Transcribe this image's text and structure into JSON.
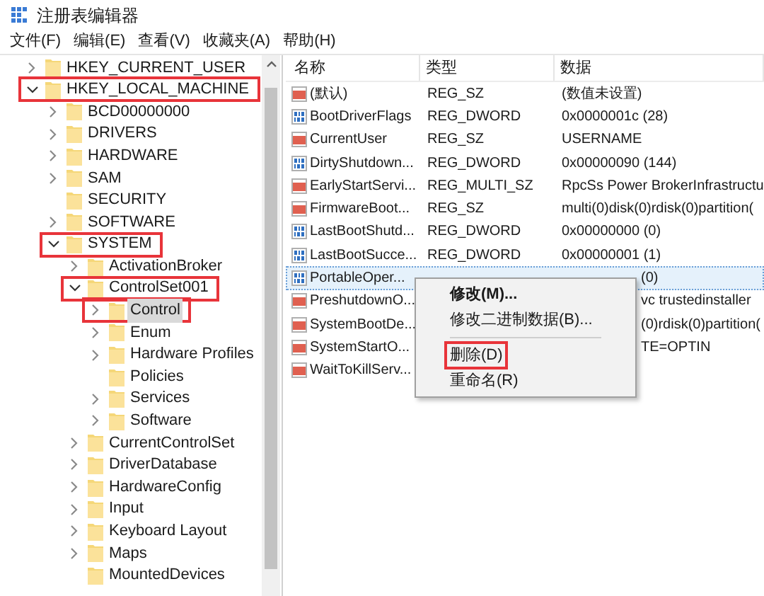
{
  "window": {
    "title": "注册表编辑器"
  },
  "menu_bar": [
    "文件(F)",
    "编辑(E)",
    "查看(V)",
    "收藏夹(A)",
    "帮助(H)"
  ],
  "tree": [
    {
      "label": "HKEY_CURRENT_USER",
      "expandable": true,
      "expanded": false,
      "selected": false,
      "highlighted": false
    },
    {
      "label": "HKEY_LOCAL_MACHINE",
      "expandable": true,
      "expanded": true,
      "selected": false,
      "highlighted": true,
      "children": [
        {
          "label": "BCD00000000",
          "expandable": true,
          "expanded": false,
          "selected": false,
          "highlighted": false
        },
        {
          "label": "DRIVERS",
          "expandable": true,
          "expanded": false,
          "selected": false,
          "highlighted": false
        },
        {
          "label": "HARDWARE",
          "expandable": true,
          "expanded": false,
          "selected": false,
          "highlighted": false
        },
        {
          "label": "SAM",
          "expandable": true,
          "expanded": false,
          "selected": false,
          "highlighted": false
        },
        {
          "label": "SECURITY",
          "expandable": false,
          "expanded": false,
          "selected": false,
          "highlighted": false
        },
        {
          "label": "SOFTWARE",
          "expandable": true,
          "expanded": false,
          "selected": false,
          "highlighted": false
        },
        {
          "label": "SYSTEM",
          "expandable": true,
          "expanded": true,
          "selected": false,
          "highlighted": true,
          "children": [
            {
              "label": "ActivationBroker",
              "expandable": true,
              "expanded": false,
              "selected": false,
              "highlighted": false
            },
            {
              "label": "ControlSet001",
              "expandable": true,
              "expanded": true,
              "selected": false,
              "highlighted": true,
              "children": [
                {
                  "label": "Control",
                  "expandable": true,
                  "expanded": false,
                  "selected": true,
                  "highlighted": true
                },
                {
                  "label": "Enum",
                  "expandable": true,
                  "expanded": false,
                  "selected": false,
                  "highlighted": false
                },
                {
                  "label": "Hardware Profiles",
                  "expandable": true,
                  "expanded": false,
                  "selected": false,
                  "highlighted": false
                },
                {
                  "label": "Policies",
                  "expandable": false,
                  "expanded": false,
                  "selected": false,
                  "highlighted": false
                },
                {
                  "label": "Services",
                  "expandable": true,
                  "expanded": false,
                  "selected": false,
                  "highlighted": false
                },
                {
                  "label": "Software",
                  "expandable": true,
                  "expanded": false,
                  "selected": false,
                  "highlighted": false
                }
              ]
            },
            {
              "label": "CurrentControlSet",
              "expandable": true,
              "expanded": false,
              "selected": false,
              "highlighted": false
            },
            {
              "label": "DriverDatabase",
              "expandable": true,
              "expanded": false,
              "selected": false,
              "highlighted": false
            },
            {
              "label": "HardwareConfig",
              "expandable": true,
              "expanded": false,
              "selected": false,
              "highlighted": false
            },
            {
              "label": "Input",
              "expandable": true,
              "expanded": false,
              "selected": false,
              "highlighted": false
            },
            {
              "label": "Keyboard Layout",
              "expandable": true,
              "expanded": false,
              "selected": false,
              "highlighted": false
            },
            {
              "label": "Maps",
              "expandable": true,
              "expanded": false,
              "selected": false,
              "highlighted": false
            },
            {
              "label": "MountedDevices",
              "expandable": false,
              "expanded": false,
              "selected": false,
              "highlighted": false
            }
          ]
        }
      ]
    }
  ],
  "table": {
    "columns": [
      "名称",
      "类型",
      "数据"
    ],
    "rows": [
      {
        "kind": "string",
        "name": "(默认)",
        "type": "REG_SZ",
        "data": "(数值未设置)",
        "selected": false
      },
      {
        "kind": "binary",
        "name": "BootDriverFlags",
        "type": "REG_DWORD",
        "data": "0x0000001c (28)",
        "selected": false
      },
      {
        "kind": "string",
        "name": "CurrentUser",
        "type": "REG_SZ",
        "data": "USERNAME",
        "selected": false
      },
      {
        "kind": "binary",
        "name": "DirtyShutdown...",
        "type": "REG_DWORD",
        "data": "0x00000090 (144)",
        "selected": false
      },
      {
        "kind": "string",
        "name": "EarlyStartServi...",
        "type": "REG_MULTI_SZ",
        "data": "RpcSs Power BrokerInfrastructu",
        "selected": false
      },
      {
        "kind": "string",
        "name": "FirmwareBoot...",
        "type": "REG_SZ",
        "data": "multi(0)disk(0)rdisk(0)partition(",
        "selected": false
      },
      {
        "kind": "binary",
        "name": "LastBootShutd...",
        "type": "REG_DWORD",
        "data": "0x00000000 (0)",
        "selected": false
      },
      {
        "kind": "binary",
        "name": "LastBootSucce...",
        "type": "REG_DWORD",
        "data": "0x00000001 (1)",
        "selected": false
      },
      {
        "kind": "binary",
        "name": "PortableOper...",
        "data": "(0)",
        "selected": true
      },
      {
        "kind": "string",
        "name": "PreshutdownO...",
        "data": "vc trustedinstaller",
        "selected": false
      },
      {
        "kind": "string",
        "name": "SystemBootDe...",
        "data": "(0)rdisk(0)partition(",
        "selected": false
      },
      {
        "kind": "string",
        "name": "SystemStartO...",
        "data": "TE=OPTIN",
        "selected": false
      },
      {
        "kind": "string",
        "name": "WaitToKillServ...",
        "selected": false
      }
    ]
  },
  "context_menu": [
    {
      "kind": "item",
      "label": "修改(M)...",
      "default": true,
      "highlighted": false
    },
    {
      "kind": "item",
      "label": "修改二进制数据(B)...",
      "default": false,
      "highlighted": false
    },
    {
      "kind": "separator"
    },
    {
      "kind": "item",
      "label": "删除(D)",
      "default": false,
      "highlighted": true
    },
    {
      "kind": "item",
      "label": "重命名(R)",
      "default": false,
      "highlighted": false
    }
  ]
}
